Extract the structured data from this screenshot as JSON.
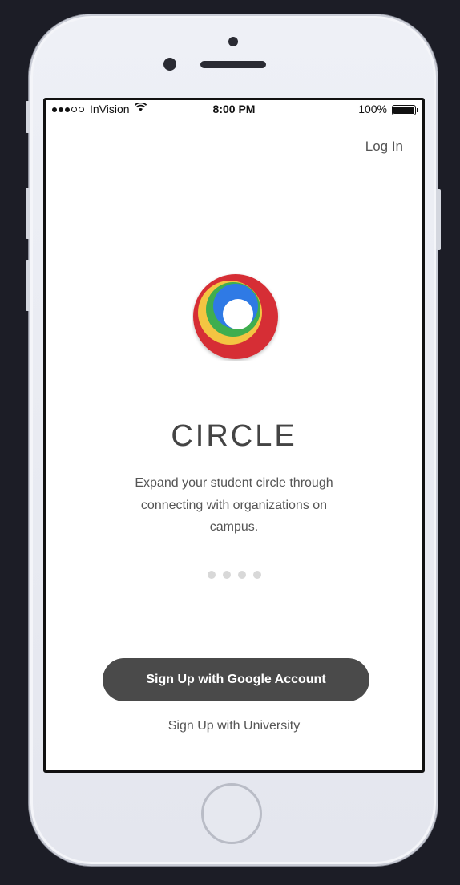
{
  "status_bar": {
    "carrier": "InVision",
    "time": "8:00 PM",
    "battery": "100%"
  },
  "header": {
    "login_label": "Log In"
  },
  "app": {
    "title": "CIRCLE",
    "tagline": "Expand your student circle through connecting with organizations on campus.",
    "logo_colors": {
      "red": "#d62f35",
      "yellow": "#f4c542",
      "green": "#3fae4f",
      "blue": "#2f7ae5"
    }
  },
  "pagination": {
    "dots": 4
  },
  "actions": {
    "google_signup_label": "Sign Up with Google Account",
    "university_signup_label": "Sign Up with University"
  },
  "colors": {
    "background": "#1c1d26",
    "button": "#4a4a4a",
    "text": "#555555"
  }
}
